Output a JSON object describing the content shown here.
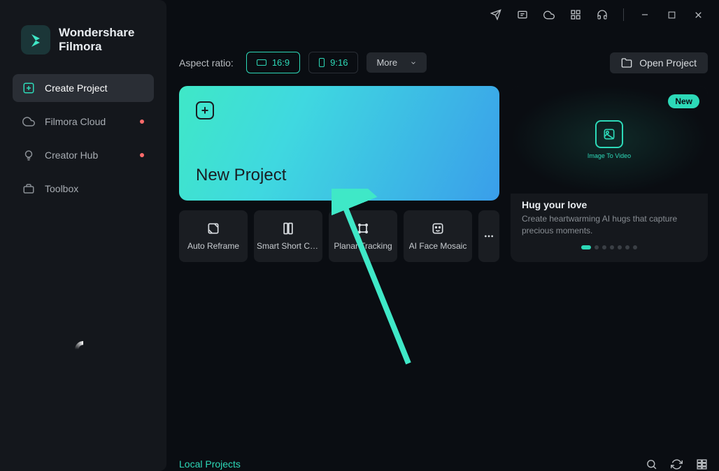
{
  "brand": {
    "line1": "Wondershare",
    "line2": "Filmora"
  },
  "sidebar": {
    "items": [
      {
        "label": "Create Project",
        "active": true,
        "dot": false
      },
      {
        "label": "Filmora Cloud",
        "active": false,
        "dot": true
      },
      {
        "label": "Creator Hub",
        "active": false,
        "dot": true
      },
      {
        "label": "Toolbox",
        "active": false,
        "dot": false
      }
    ]
  },
  "toolbar": {
    "aspect_label": "Aspect ratio:",
    "ratio_169": "16:9",
    "ratio_916": "9:16",
    "more_label": "More",
    "open_project": "Open Project"
  },
  "new_project": {
    "title": "New Project"
  },
  "tools": [
    {
      "label": "Auto Reframe"
    },
    {
      "label": "Smart Short Cli..."
    },
    {
      "label": "Planar Tracking"
    },
    {
      "label": "AI Face Mosaic"
    }
  ],
  "promo": {
    "badge": "New",
    "icon_label": "Image To Video",
    "title": "Hug your love",
    "desc": "Create heartwarming AI hugs that capture precious moments."
  },
  "local": {
    "title": "Local Projects"
  }
}
